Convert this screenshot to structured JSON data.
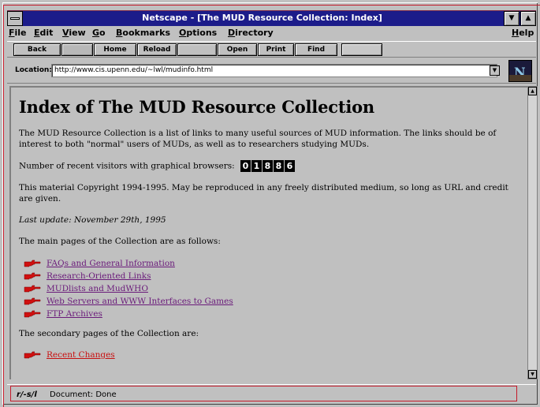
{
  "window": {
    "title": "Netscape - [The MUD Resource Collection: Index]"
  },
  "menu": [
    {
      "label": "File",
      "ul": "F",
      "rest": "ile"
    },
    {
      "label": "Edit",
      "ul": "E",
      "rest": "dit"
    },
    {
      "label": "View",
      "ul": "V",
      "rest": "iew"
    },
    {
      "label": "Go",
      "ul": "G",
      "rest": "o"
    },
    {
      "label": "Bookmarks",
      "ul": "B",
      "rest": "ookmarks"
    },
    {
      "label": "Options",
      "ul": "O",
      "rest": "ptions"
    },
    {
      "label": "Directory",
      "ul": "D",
      "rest": "irectory"
    },
    {
      "label": "Help",
      "ul": "H",
      "rest": "elp"
    }
  ],
  "toolbar": {
    "back": "Back",
    "home": "Home",
    "reload": "Reload",
    "open": "Open",
    "print": "Print",
    "find": "Find"
  },
  "location": {
    "label": "Location:",
    "url": "http://www.cis.upenn.edu/~lwl/mudinfo.html"
  },
  "page": {
    "heading": "Index of The MUD Resource Collection",
    "intro": "The MUD Resource Collection is a list of links to many useful sources of MUD information. The links should be of interest to both \"normal\" users of MUDs, as well as to researchers studying MUDs.",
    "visitors_label": "Number of recent visitors with graphical browsers:",
    "visitors_digits": [
      "0",
      "1",
      "8",
      "8",
      "6"
    ],
    "copyright": "This material Copyright 1994-1995. May be reproduced in any freely distributed medium, so long as URL and credit are given.",
    "last_update": "Last update: November 29th, 1995",
    "main_pages_intro": "The main pages of the Collection are as follows:",
    "main_links": [
      "FAQs and General Information",
      "Research-Oriented Links",
      "MUDlists and MudWHO",
      "Web Servers and WWW Interfaces to Games",
      "FTP Archives"
    ],
    "secondary_intro": "The secondary pages of the Collection are:",
    "secondary_partial": "Recent Changes"
  },
  "status": {
    "icon_text": "r/-s/l",
    "text": "Document: Done"
  },
  "colors": {
    "title_bar": "#1c1c8a",
    "link": "#6a1a7a",
    "background": "#c0c0c0"
  }
}
